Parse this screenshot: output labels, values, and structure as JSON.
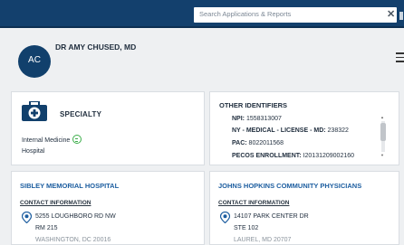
{
  "header": {
    "search_placeholder": "Search Applications & Reports",
    "close_glyph": "✕"
  },
  "profile": {
    "avatar_initials": "AC",
    "name": "DR AMY CHUSED, MD",
    "menu_icon": "hamburger-icon"
  },
  "specialty": {
    "title": "SPECIALTY",
    "icon": "medical-bag-icon",
    "items": [
      "Internal Medicine",
      "Hospital"
    ],
    "badge_color": "#3cae4a"
  },
  "identifiers": {
    "title": "OTHER IDENTIFIERS",
    "rows": [
      {
        "label": "NPI:",
        "value": "1558313007"
      },
      {
        "label": "NY - MEDICAL - LICENSE - MD:",
        "value": "238322"
      },
      {
        "label": "PAC:",
        "value": "8022011568"
      },
      {
        "label": "PECOS ENROLLMENT:",
        "value": "I20131209002160"
      }
    ]
  },
  "hospitals": [
    {
      "name": "SIBLEY MEMORIAL HOSPITAL",
      "contact_label": "CONTACT INFORMATION",
      "address_lines": [
        "5255 LOUGHBORO RD NW",
        "RM 215",
        "WASHINGTON, DC 20016"
      ]
    },
    {
      "name": "JOHNS HOPKINS COMMUNITY PHYSICIANS",
      "contact_label": "CONTACT INFORMATION",
      "address_lines": [
        "14107 PARK CENTER DR",
        "STE 102",
        "LAUREL, MD 20707"
      ]
    }
  ],
  "colors": {
    "topbar": "#13406d",
    "avatar": "#11406c",
    "hospital_link": "#1d5ea0"
  }
}
